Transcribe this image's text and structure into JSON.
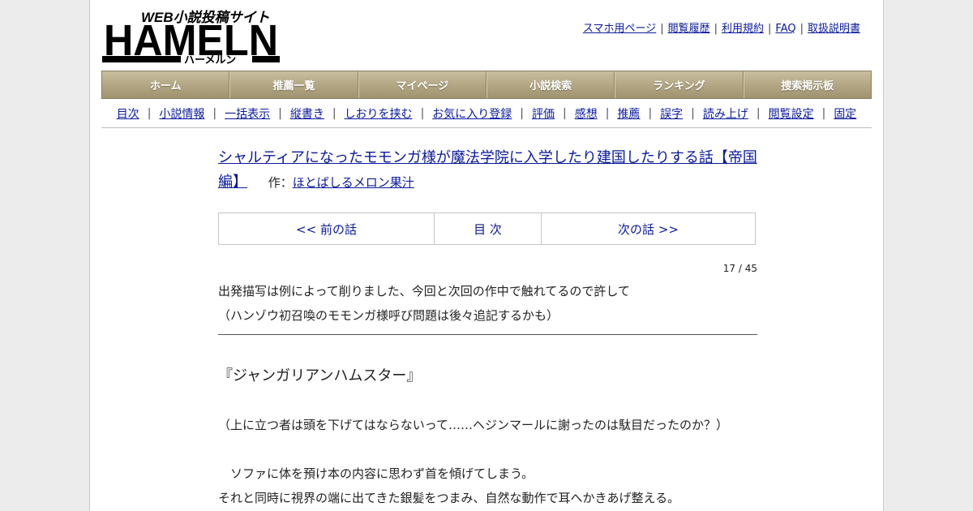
{
  "logo": {
    "tagline": "WEB小説投稿サイト",
    "name": "HAMELN",
    "kana": "ハーメルン"
  },
  "header_links": [
    "スマホ用ページ",
    "閲覧履歴",
    "利用規約",
    "FAQ",
    "取扱説明書"
  ],
  "main_nav": [
    "ホーム",
    "推薦一覧",
    "マイページ",
    "小説検索",
    "ランキング",
    "捜索掲示板"
  ],
  "sub_nav": [
    "目次",
    "小説情報",
    "一括表示",
    "縦書き",
    "しおりを挟む",
    "お気に入り登録",
    "評価",
    "感想",
    "推薦",
    "誤字",
    "読み上げ",
    "閲覧設定",
    "固定"
  ],
  "novel": {
    "title": "シャルティアになったモモンガ様が魔法学院に入学したり建国したりする話【帝国編】",
    "author_label": "作：",
    "author": "ほとばしるメロン果汁"
  },
  "chapter_nav": {
    "prev": "<< 前の話",
    "index": "目 次",
    "next": "次の話 >>"
  },
  "page_counter": "17 / 45",
  "foreword": [
    "出発描写は例によって削りました、今回と次回の作中で触れてるので許して",
    "（ハンゾウ初召喚のモモンガ様呼び問題は後々追記するかも）"
  ],
  "body": {
    "line1": "『ジャンガリアンハムスター』",
    "line2": "（上に立つ者は頭を下げてはならないって……ヘジンマールに謝ったのは駄目だったのか？）",
    "line3": "　ソファに体を預け本の内容に思わず首を傾げてしまう。",
    "line4": "それと同時に視界の端に出てきた銀髪をつまみ、自然な動作で耳へかきあげ整える。"
  }
}
